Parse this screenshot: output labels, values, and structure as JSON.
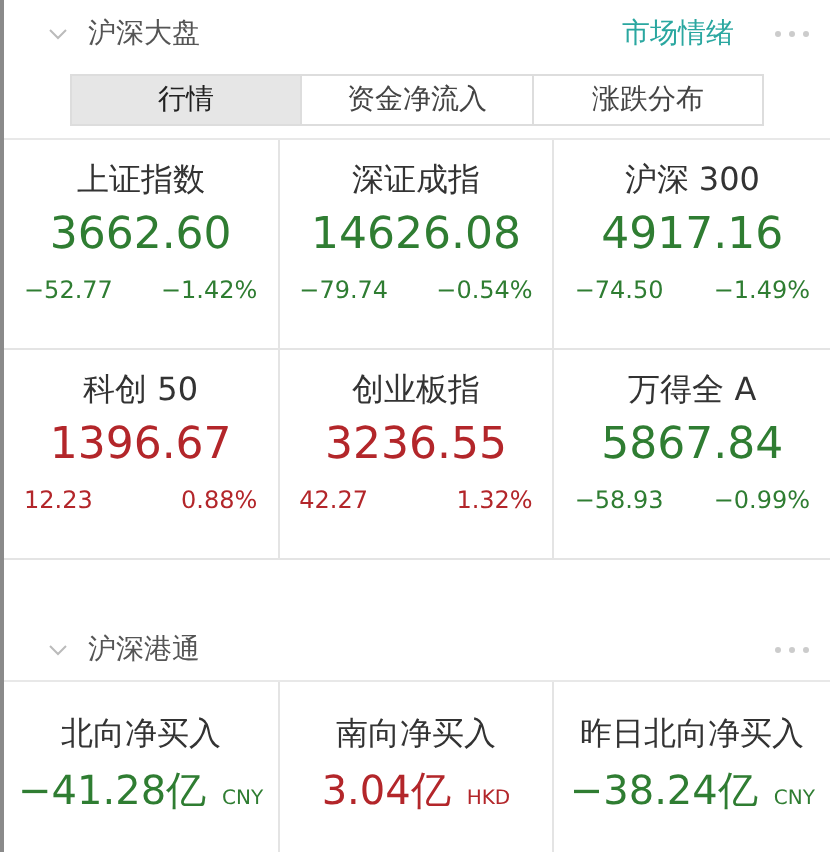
{
  "market": {
    "title": "沪深大盘",
    "link": "市场情绪",
    "tabs": [
      {
        "label": "行情",
        "selected": true
      },
      {
        "label": "资金净流入",
        "selected": false
      },
      {
        "label": "涨跌分布",
        "selected": false
      }
    ],
    "indices": [
      {
        "name": "上证指数",
        "value": "3662.60",
        "change": "−52.77",
        "percent": "−1.42%",
        "color": "#2f7d32"
      },
      {
        "name": "深证成指",
        "value": "14626.08",
        "change": "−79.74",
        "percent": "−0.54%",
        "color": "#2f7d32"
      },
      {
        "name": "沪深 300",
        "value": "4917.16",
        "change": "−74.50",
        "percent": "−1.49%",
        "color": "#2f7d32"
      },
      {
        "name": "科创 50",
        "value": "1396.67",
        "change": "12.23",
        "percent": "0.88%",
        "color": "#b3262a"
      },
      {
        "name": "创业板指",
        "value": "3236.55",
        "change": "42.27",
        "percent": "1.32%",
        "color": "#b3262a"
      },
      {
        "name": "万得全 A",
        "value": "5867.84",
        "change": "−58.93",
        "percent": "−0.99%",
        "color": "#2f7d32"
      }
    ]
  },
  "connect": {
    "title": "沪深港通",
    "flows": [
      {
        "name": "北向净买入",
        "value": "−41.28亿",
        "unit": "CNY",
        "color": "#2f7d32"
      },
      {
        "name": "南向净买入",
        "value": "3.04亿",
        "unit": "HKD",
        "color": "#b3262a"
      },
      {
        "name": "昨日北向净买入",
        "value": "−38.24亿",
        "unit": "CNY",
        "color": "#2f7d32"
      }
    ]
  }
}
